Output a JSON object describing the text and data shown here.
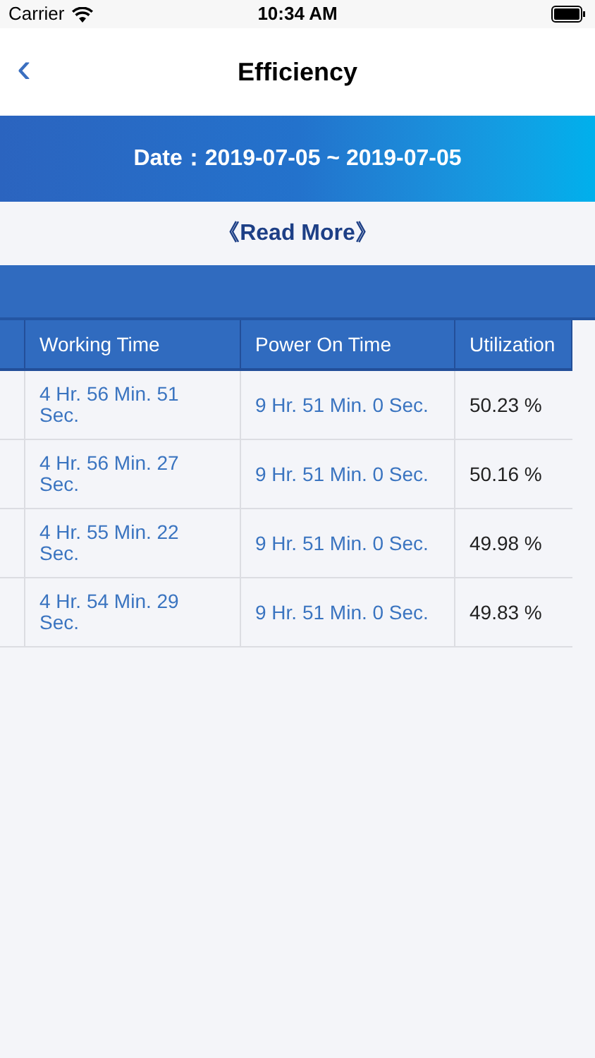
{
  "status_bar": {
    "carrier": "Carrier",
    "time": "10:34 AM"
  },
  "nav": {
    "title": "Efficiency",
    "back": "‹"
  },
  "date_banner": "Date：2019-07-05 ~ 2019-07-05",
  "read_more": "《Read More》",
  "table": {
    "columns": [
      "Working Time",
      "Power On Time",
      "Utilization"
    ],
    "rows": [
      {
        "working_time": "4 Hr. 56 Min. 51 Sec.",
        "power_on_time": "9 Hr. 51 Min. 0 Sec.",
        "utilization": "50.23 %"
      },
      {
        "working_time": "4 Hr. 56 Min. 27 Sec.",
        "power_on_time": "9 Hr. 51 Min. 0 Sec.",
        "utilization": "50.16 %"
      },
      {
        "working_time": "4 Hr. 55 Min. 22 Sec.",
        "power_on_time": "9 Hr. 51 Min. 0 Sec.",
        "utilization": "49.98 %"
      },
      {
        "working_time": "4 Hr. 54 Min. 29 Sec.",
        "power_on_time": "9 Hr. 51 Min. 0 Sec.",
        "utilization": "49.83 %"
      }
    ]
  }
}
